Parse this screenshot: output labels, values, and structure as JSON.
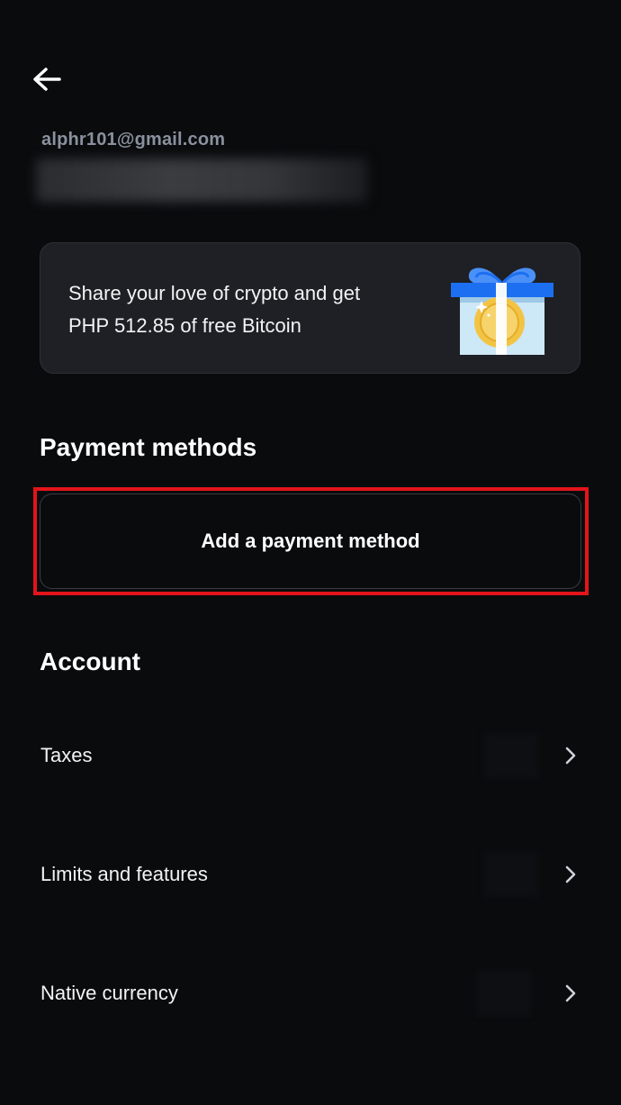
{
  "header": {
    "back_icon": "arrow-left-icon"
  },
  "profile": {
    "email": "alphr101@gmail.com"
  },
  "promo": {
    "text_line1": "Share your love of crypto and get",
    "text_line2": "PHP 512.85 of free Bitcoin",
    "icon": "gift-box-bitcoin-icon"
  },
  "payment_methods": {
    "title": "Payment methods",
    "add_label": "Add a payment method"
  },
  "account": {
    "title": "Account",
    "items": [
      {
        "label": "Taxes",
        "icon": "chevron-right-icon"
      },
      {
        "label": "Limits and features",
        "icon": "chevron-right-icon"
      },
      {
        "label": "Native currency",
        "icon": "chevron-right-icon"
      }
    ]
  },
  "colors": {
    "background": "#0a0b0d",
    "card": "#1e2025",
    "highlight": "#e3141b",
    "muted_text": "#8a919e",
    "gift_blue": "#1d6ff2",
    "gift_body": "#cde8f7",
    "coin": "#f3c443"
  }
}
